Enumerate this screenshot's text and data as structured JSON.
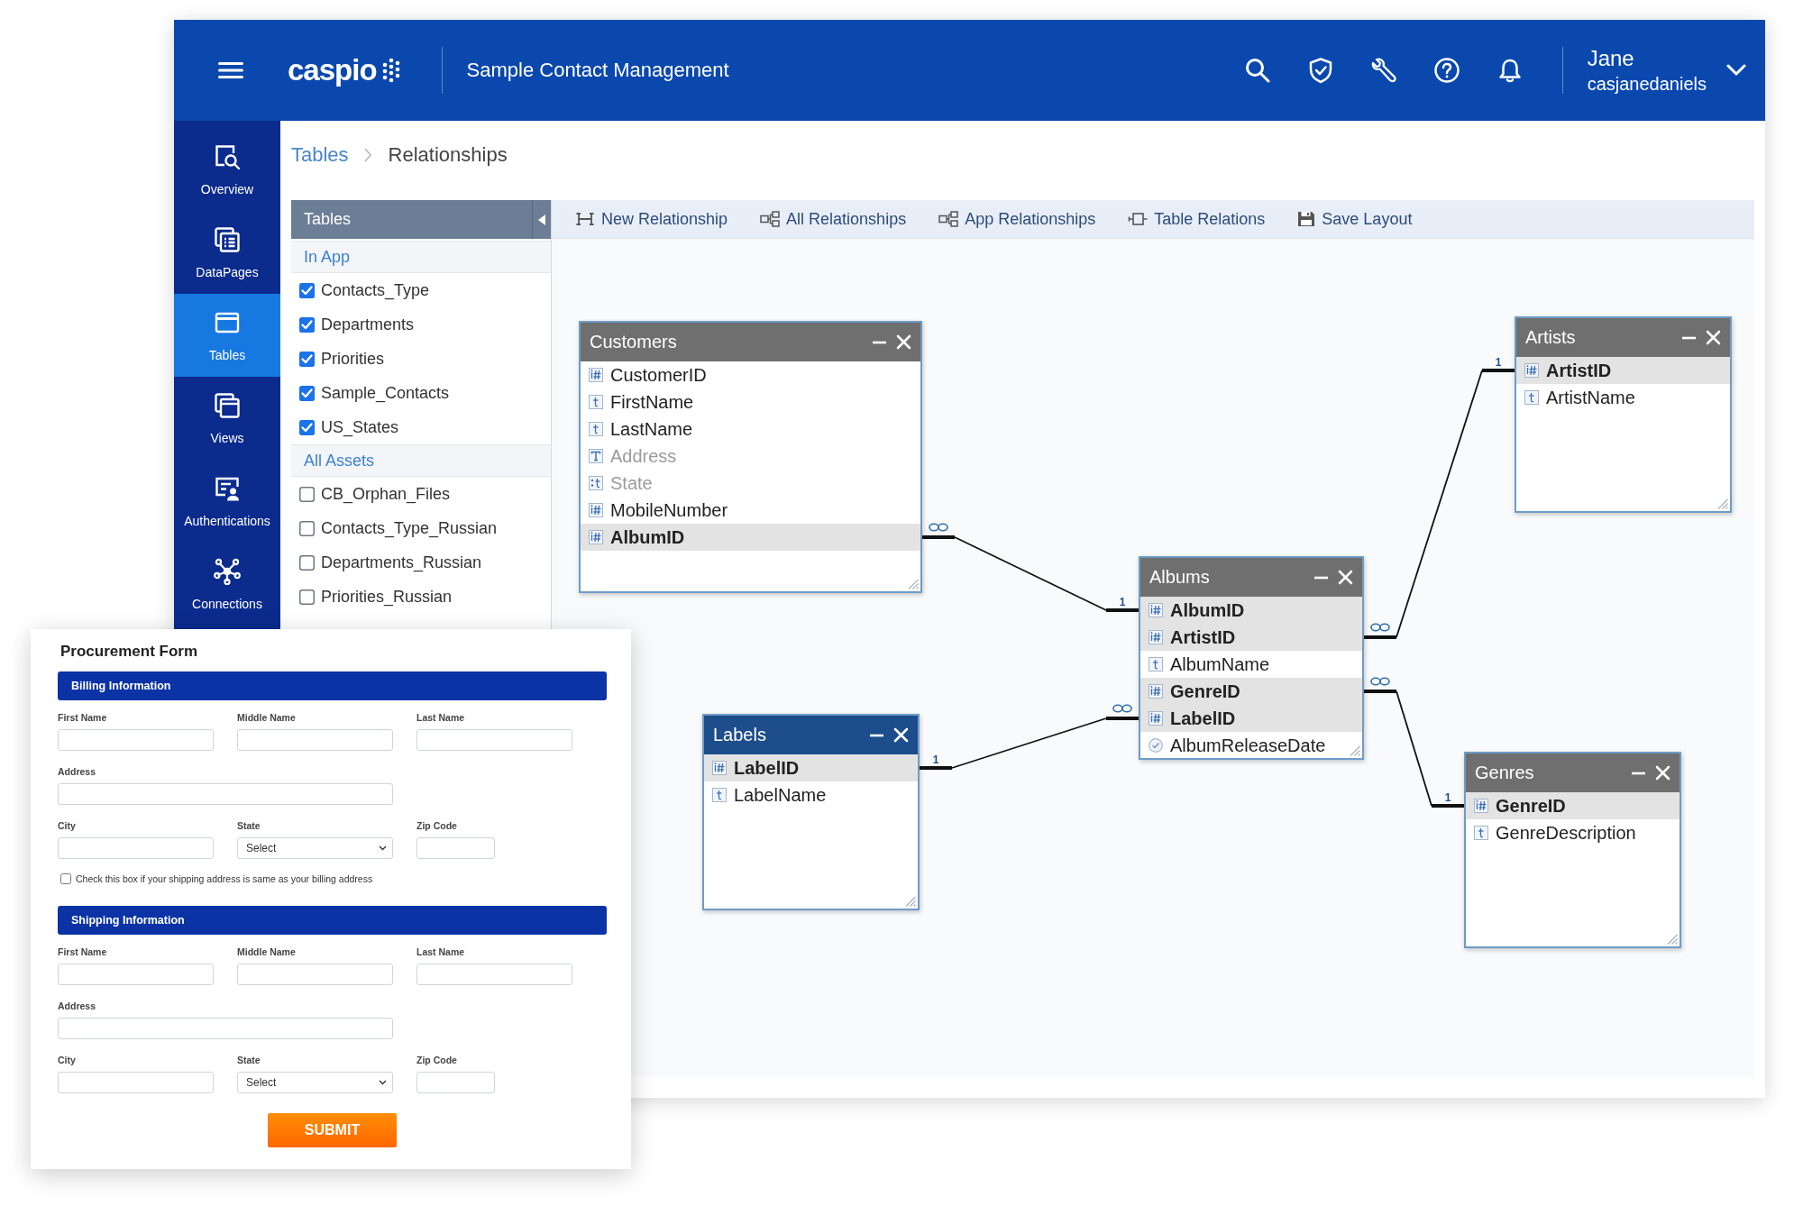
{
  "header": {
    "logo": "caspio",
    "app_name": "Sample Contact Management",
    "user": {
      "name": "Jane",
      "username": "casjanedaniels"
    }
  },
  "sidebar": {
    "items": [
      {
        "label": "Overview",
        "selected": false
      },
      {
        "label": "DataPages",
        "selected": false
      },
      {
        "label": "Tables",
        "selected": true
      },
      {
        "label": "Views",
        "selected": false
      },
      {
        "label": "Authentications",
        "selected": false
      },
      {
        "label": "Connections",
        "selected": false
      }
    ]
  },
  "breadcrumb": [
    {
      "label": "Tables",
      "kind": "link"
    },
    {
      "label": "Relationships",
      "kind": "current"
    }
  ],
  "tables_panel": {
    "title": "Tables",
    "groups": [
      {
        "title": "In App",
        "items": [
          {
            "label": "Contacts_Type",
            "checked": true
          },
          {
            "label": "Departments",
            "checked": true
          },
          {
            "label": "Priorities",
            "checked": true
          },
          {
            "label": "Sample_Contacts",
            "checked": true
          },
          {
            "label": "US_States",
            "checked": true
          }
        ]
      },
      {
        "title": "All Assets",
        "items": [
          {
            "label": "CB_Orphan_Files",
            "checked": false
          },
          {
            "label": "Contacts_Type_Russian",
            "checked": false
          },
          {
            "label": "Departments_Russian",
            "checked": false
          },
          {
            "label": "Priorities_Russian",
            "checked": false
          }
        ]
      }
    ]
  },
  "toolbar": [
    {
      "label": "New Relationship"
    },
    {
      "label": "All Relationships"
    },
    {
      "label": "App Relationships"
    },
    {
      "label": "Table Relations"
    },
    {
      "label": "Save Layout"
    }
  ],
  "diagram": {
    "tables": [
      {
        "name": "Customers",
        "selected": false,
        "fields": [
          {
            "name": "CustomerID",
            "kind": "number",
            "key": false,
            "disabled": false
          },
          {
            "name": "FirstName",
            "kind": "text",
            "key": false,
            "disabled": false
          },
          {
            "name": "LastName",
            "kind": "text",
            "key": false,
            "disabled": false
          },
          {
            "name": "Address",
            "kind": "memo",
            "key": false,
            "disabled": true
          },
          {
            "name": "State",
            "kind": "list",
            "key": false,
            "disabled": true
          },
          {
            "name": "MobileNumber",
            "kind": "number",
            "key": false,
            "disabled": false
          },
          {
            "name": "AlbumID",
            "kind": "number",
            "key": true,
            "disabled": false
          }
        ]
      },
      {
        "name": "Artists",
        "selected": false,
        "fields": [
          {
            "name": "ArtistID",
            "kind": "number",
            "key": true,
            "disabled": false
          },
          {
            "name": "ArtistName",
            "kind": "text",
            "key": false,
            "disabled": false
          }
        ]
      },
      {
        "name": "Albums",
        "selected": false,
        "fields": [
          {
            "name": "AlbumID",
            "kind": "number",
            "key": true,
            "disabled": false
          },
          {
            "name": "ArtistID",
            "kind": "number",
            "key": true,
            "disabled": false
          },
          {
            "name": "AlbumName",
            "kind": "text",
            "key": false,
            "disabled": false
          },
          {
            "name": "GenreID",
            "kind": "number",
            "key": true,
            "disabled": false
          },
          {
            "name": "LabelID",
            "kind": "number",
            "key": true,
            "disabled": false
          },
          {
            "name": "AlbumReleaseDate",
            "kind": "date",
            "key": false,
            "disabled": false
          }
        ]
      },
      {
        "name": "Labels",
        "selected": true,
        "fields": [
          {
            "name": "LabelID",
            "kind": "number",
            "key": true,
            "disabled": false
          },
          {
            "name": "LabelName",
            "kind": "text",
            "key": false,
            "disabled": false
          }
        ]
      },
      {
        "name": "Genres",
        "selected": false,
        "fields": [
          {
            "name": "GenreID",
            "kind": "number",
            "key": true,
            "disabled": false
          },
          {
            "name": "GenreDescription",
            "kind": "text",
            "key": false,
            "disabled": false
          }
        ]
      }
    ],
    "connectors": [
      {
        "one_label": "1"
      },
      {
        "one_label": "1"
      },
      {
        "one_label": "1"
      },
      {
        "one_label": "1"
      }
    ]
  },
  "form": {
    "title": "Procurement Form",
    "sections": [
      {
        "title": "Billing Information",
        "fields": [
          {
            "label": "First Name",
            "kind": "text"
          },
          {
            "label": "Middle Name",
            "kind": "text"
          },
          {
            "label": "Last Name",
            "kind": "text"
          },
          {
            "label": "Address",
            "kind": "wide"
          },
          {
            "label": "City",
            "kind": "text"
          },
          {
            "label": "State",
            "kind": "select",
            "value": "Select"
          },
          {
            "label": "Zip Code",
            "kind": "short"
          }
        ],
        "checkbox": {
          "label": "Check this box if your shipping address is same as your billing address",
          "checked": false
        }
      },
      {
        "title": "Shipping Information",
        "fields": [
          {
            "label": "First Name",
            "kind": "text"
          },
          {
            "label": "Middle Name",
            "kind": "text"
          },
          {
            "label": "Last Name",
            "kind": "text"
          },
          {
            "label": "Address",
            "kind": "wide"
          },
          {
            "label": "City",
            "kind": "text"
          },
          {
            "label": "State",
            "kind": "select",
            "value": "Select"
          },
          {
            "label": "Zip Code",
            "kind": "short"
          }
        ]
      }
    ],
    "submit": "SUBMIT"
  }
}
